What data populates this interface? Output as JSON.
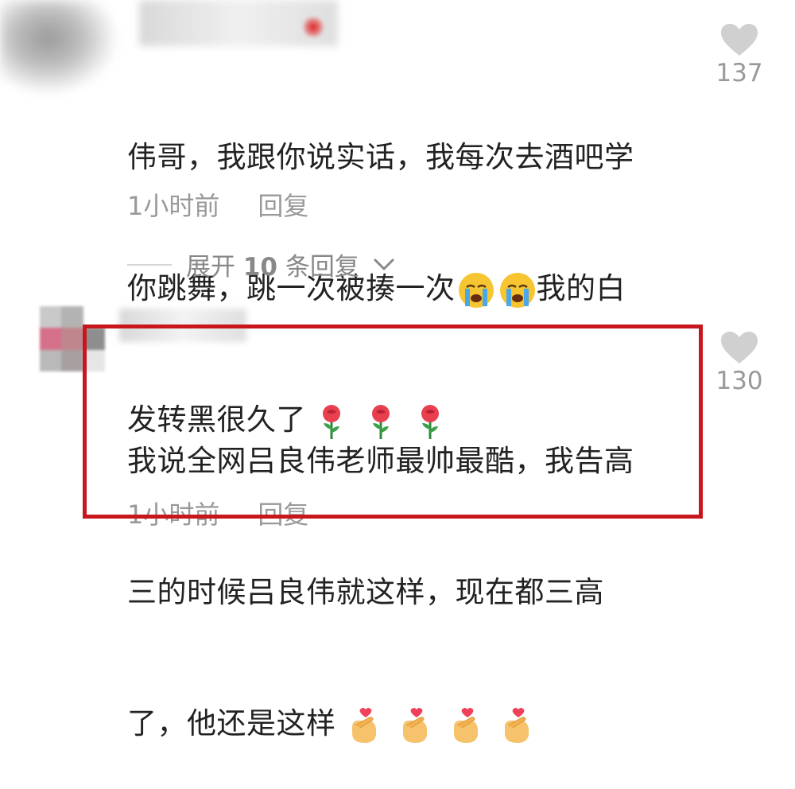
{
  "comments": [
    {
      "text_lines": [
        "伟哥，我跟你说实话，我每次去酒吧学",
        "你跳舞，跳一次被揍一次",
        "我的白",
        "发转黑很久了"
      ],
      "inline_emoji": [
        "crying-face",
        "crying-face"
      ],
      "trailing_emoji": [
        "rose",
        "rose",
        "rose"
      ],
      "time": "1小时前",
      "reply_label": "回复",
      "likes": "137"
    },
    {
      "text_lines": [
        "我说全网吕良伟老师最帅最酷，我告高",
        "三的时候吕良伟就这样，现在都三高",
        "了，他还是这样"
      ],
      "trailing_emoji": [
        "finger-heart",
        "finger-heart",
        "finger-heart",
        "finger-heart"
      ],
      "time": "1小时前",
      "reply_label": "回复",
      "likes": "130"
    }
  ],
  "expand_replies": {
    "prefix": "展开",
    "count": "10",
    "suffix": "条回复"
  },
  "colors": {
    "text": "#222222",
    "meta": "#999999",
    "heart": "#d0d0d0",
    "highlight_border": "#c8161d"
  }
}
